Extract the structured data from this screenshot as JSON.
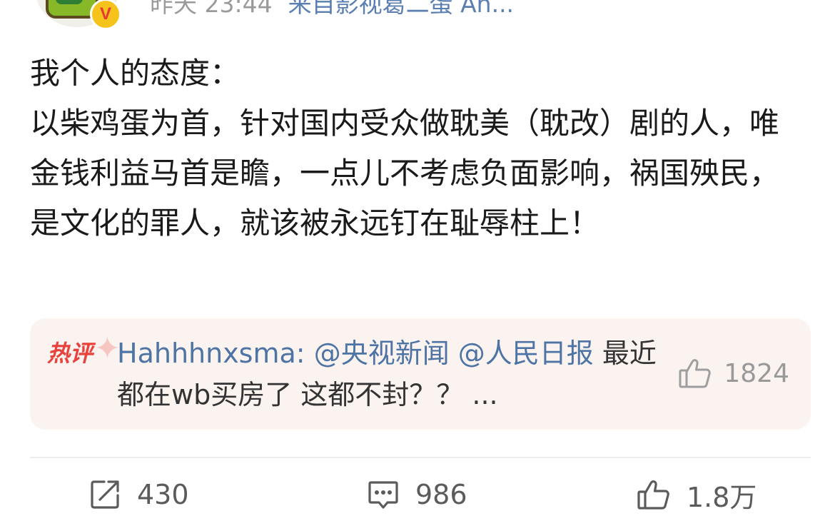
{
  "header": {
    "time": "昨天 23:44",
    "source": "来自影视葛二蛋 An...",
    "badge": "V"
  },
  "post": {
    "text": "我个人的态度：\n以柴鸡蛋为首，针对国内受众做耽美（耽改）剧的人，唯金钱利益马首是瞻，一点儿不考虑负面影响，祸国殃民，是文化的罪人，就该被永远钉在耻辱柱上！"
  },
  "hot_comment": {
    "tag": "热评",
    "user": "Hahhhnxsma:",
    "mentions": "@央视新闻 @人民日报",
    "text": "最近都在wb买房了 这都不封？？ ...",
    "likes": "1824"
  },
  "actions": {
    "reposts": "430",
    "comments": "986",
    "likes": "1.8万"
  },
  "colors": {
    "link_blue": "#4e74a5",
    "hot_red": "#e8423c",
    "card_bg": "#fbf3f0",
    "badge_gold": "#f6c21c"
  },
  "icons": {
    "repost": "share-arrow-icon",
    "comment": "comment-bubble-icon",
    "like": "thumbs-up-icon",
    "verified": "verified-v-icon"
  }
}
